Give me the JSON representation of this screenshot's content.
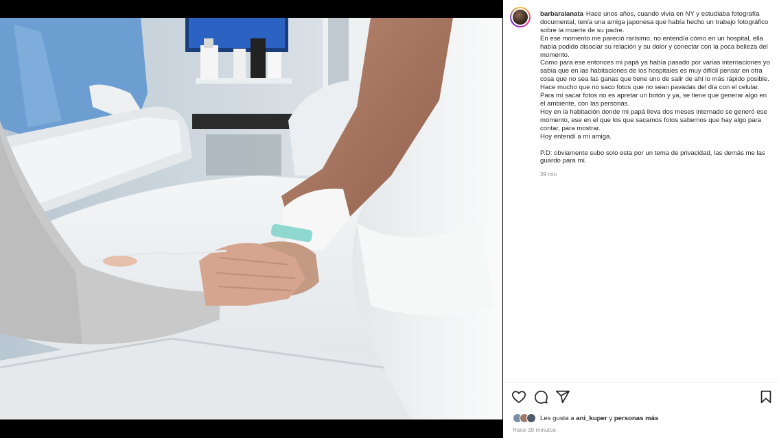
{
  "post": {
    "username": "barbaralanata",
    "caption_first": "Hace unos años, cuando vivía en NY y estudiaba fotografía documental, tenía una amiga japonesa que había hecho un trabajo fotográfico sobre la muerte de su padre.\nEn ese momento me pareció rarísimo, no entendía cómo en un hospital, ella había podido disociar su relación y su dolor y conectar con la poca belleza del momento.\nComo para ese entonces mi papá ya había pasado por varias internaciones yo sabía que en las habitaciones de los hospitales es muy difícil pensar en otra cosa que no sea las ganas que tiene uno de salir de ahí lo más rápido posible.\nHace mucho que no saco fotos que no sean pavadas del día con el celular. Para mí sacar fotos no es apretar un botón y ya, se tiene que generar algo en el ambiente, con las personas.\nHoy en la habitación donde mi papá lleva dos meses internado se generó ese momento, ese en el que los que sacamos fotos sabemos que hay algo para contar, para mostrar.\nHoy entendí a mi amiga.",
    "caption_pd": "P.D: obviamente subo solo esta por un tema de privacidad, las demás me las guardo para mí.",
    "caption_time": "39 min",
    "likes_prefix": "Les gusta a",
    "likes_user": "ani_kuper",
    "likes_mid": "y",
    "likes_suffix": "personas más",
    "timestamp": "Hace 39 minutos"
  },
  "icons": {
    "like": "heart-icon",
    "comment": "comment-icon",
    "share": "share-icon",
    "save": "bookmark-icon"
  },
  "colors": {
    "text": "#262626",
    "muted": "#8e8e8e",
    "story_ring": "#ee2a7b"
  }
}
